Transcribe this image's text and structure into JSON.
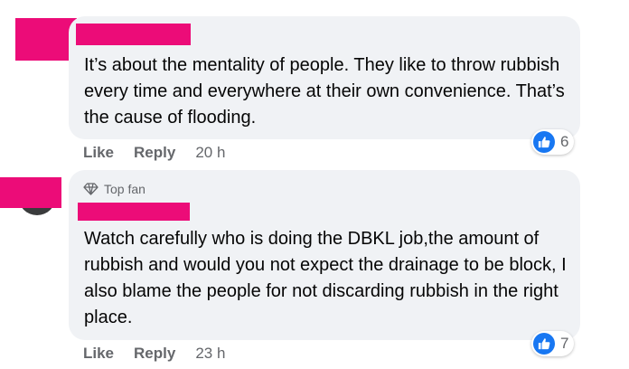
{
  "comments": [
    {
      "text": "It’s about the mentality of people. They like to throw rubbish every time and everywhere at their own convenience. That’s the cause of flooding.",
      "like_label": "Like",
      "reply_label": "Reply",
      "time": "20 h",
      "reaction_count": "6",
      "reaction_icon": "thumbs-up-icon"
    },
    {
      "badge": "Top fan",
      "badge_icon": "diamond-icon",
      "text": "Watch carefully who is doing the DBKL job,the amount of rubbish and would you not expect the drainage to be block, I also blame the people for not discarding rubbish in the right place.",
      "like_label": "Like",
      "reply_label": "Reply",
      "time": "23 h",
      "reaction_count": "7",
      "reaction_icon": "thumbs-up-icon"
    }
  ],
  "colors": {
    "bubble": "#f0f2f5",
    "redaction": "#ec0c78",
    "like_blue": "#1877f2",
    "meta_text": "#65676b"
  }
}
